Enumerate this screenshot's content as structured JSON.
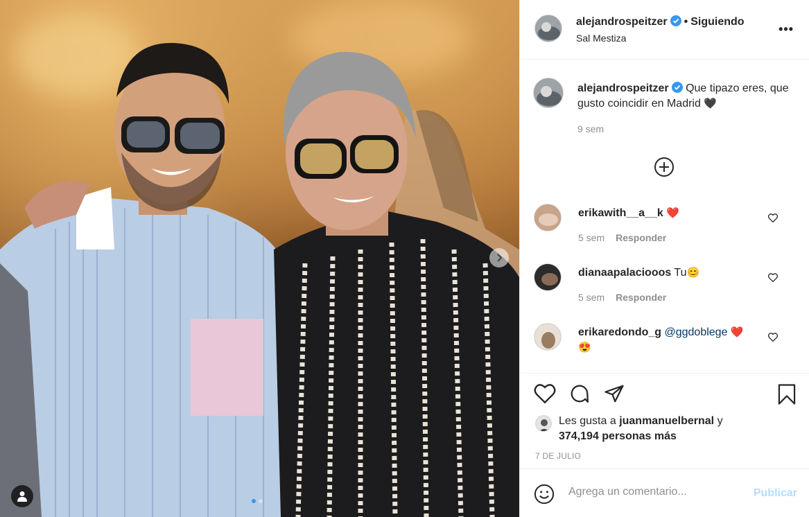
{
  "post": {
    "username": "alejandrospeitzer",
    "verified_icon": "verified-badge-icon",
    "separator": "•",
    "follow_status": "Siguiendo",
    "location": "Sal Mestiza",
    "more_icon": "more-options-icon",
    "more_label": "•••"
  },
  "caption": {
    "username": "alejandrospeitzer",
    "text": "Que tipazo eres, que gusto coincidir en Madrid",
    "emoji": "🖤",
    "time": "9 sem"
  },
  "load_more_icon": "plus-circle-icon",
  "comments": [
    {
      "username": "erikawith__a__k",
      "text": "",
      "emoji": "❤️",
      "time": "5 sem",
      "reply": "Responder"
    },
    {
      "username": "dianaapalaciooos",
      "text": "Tu",
      "emoji": "😊",
      "time": "5 sem",
      "reply": "Responder"
    },
    {
      "username": "erikaredondo_g",
      "text": "@ggdoblege",
      "emoji": "❤️",
      "emoji2": "😍",
      "time": "",
      "reply": ""
    }
  ],
  "actions": {
    "like_icon": "heart-icon",
    "comment_icon": "comment-icon",
    "share_icon": "send-icon",
    "save_icon": "bookmark-icon"
  },
  "likes": {
    "prefix": "Les gusta a",
    "user": "juanmanuelbernal",
    "conj": "y",
    "count": "374,194 personas más"
  },
  "date": "7 DE JULIO",
  "add_comment": {
    "placeholder": "Agrega un comentario...",
    "post_label": "Publicar",
    "emoji_icon": "smiley-icon"
  },
  "carousel": {
    "current": 1,
    "total": 2
  },
  "colors": {
    "verified": "#3897f0",
    "heart": "#ed4956",
    "publish_disabled": "#b2dffc",
    "mention": "#00376b"
  }
}
